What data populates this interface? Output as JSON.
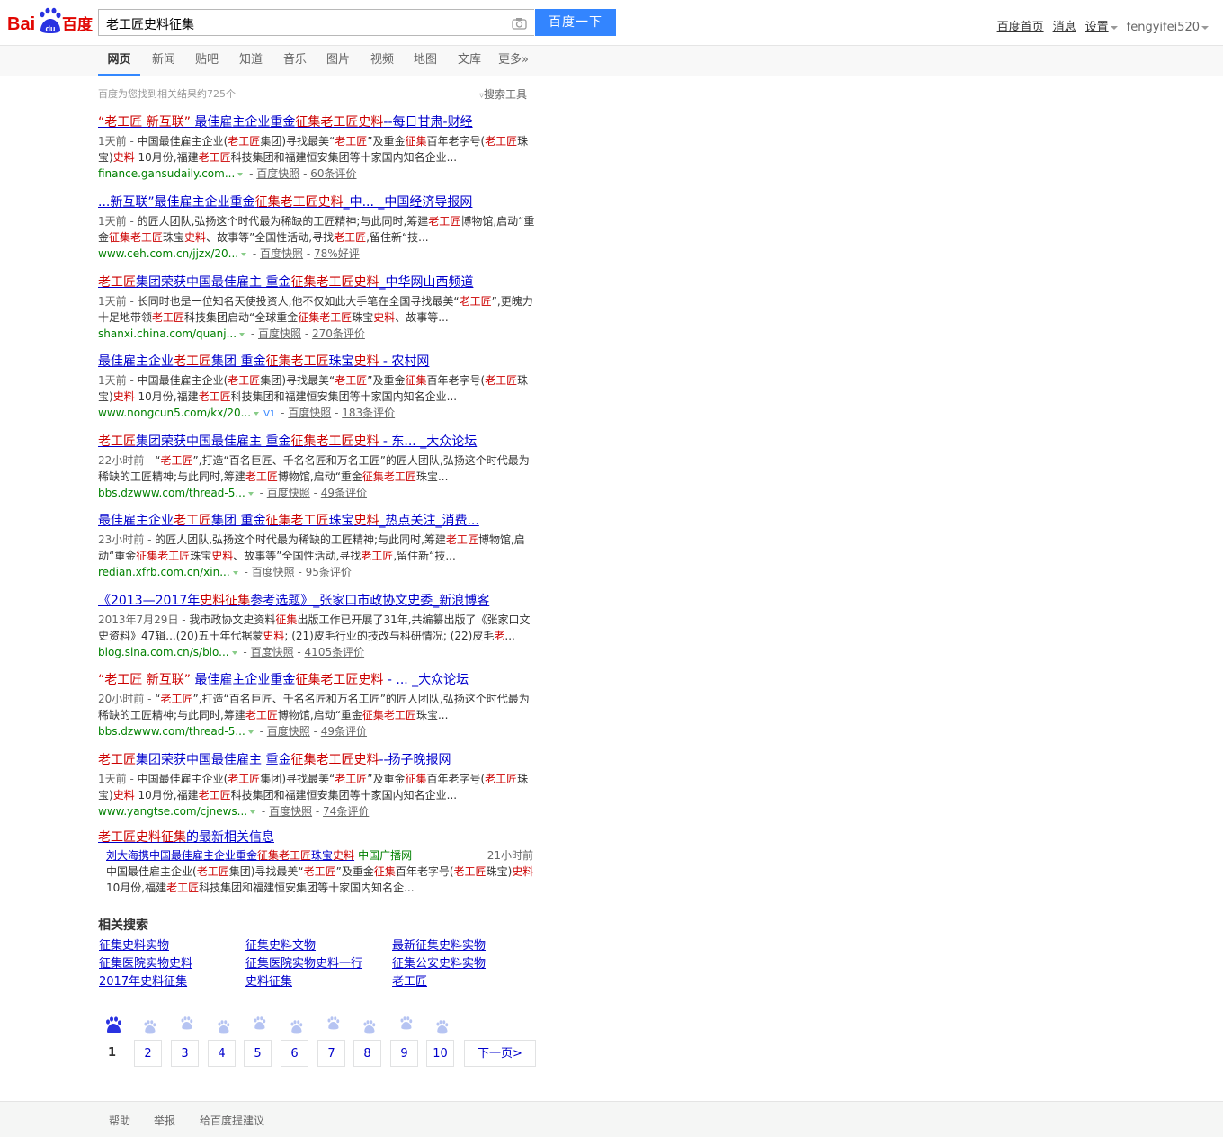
{
  "header": {
    "logo_text_left": "Bai",
    "logo_text_mid": "du",
    "logo_text_right": "百度",
    "search_value": "老工匠史料征集",
    "search_button": "百度一下",
    "user_links": [
      "百度首页",
      "消息",
      "设置",
      "fengyifei520"
    ]
  },
  "tabs": [
    "网页",
    "新闻",
    "贴吧",
    "知道",
    "音乐",
    "图片",
    "视频",
    "地图",
    "文库",
    "更多»"
  ],
  "result_count": "百度为您找到相关结果约725个",
  "search_tools": "搜索工具",
  "results": [
    {
      "title_html": "<em>“老工匠 新互联”</em> 最佳雇主企业重金<em>征集老工匠史料</em>--每日甘肃-财经",
      "date": "1天前 - ",
      "abs_html": "中国最佳雇主企业(<em>老工匠</em>集团)寻找最美“<em>老工匠</em>”及重金<em>征集</em>百年老字号(<em>老工匠</em>珠宝)<em>史料</em> 10月份,福建<em>老工匠</em>科技集团和福建恒安集团等十家国内知名企业...",
      "url": "finance.gansudaily.com...",
      "snapshot": "百度快照",
      "comment": "60条评价",
      "v": ""
    },
    {
      "title_html": "...新互联”最佳雇主企业重金<em>征集老工匠史料</em>_中... _中国经济导报网",
      "date": "1天前 - ",
      "abs_html": "的匠人团队,弘扬这个时代最为稀缺的工匠精神;与此同时,筹建<em>老工匠</em>博物馆,启动“重金<em>征集老工匠</em>珠宝<em>史料</em>、故事等”全国性活动,寻找<em>老工匠</em>,留住新“技...",
      "url": "www.ceh.com.cn/jjzx/20...",
      "snapshot": "百度快照",
      "comment": "78%好评",
      "v": ""
    },
    {
      "title_html": "<em>老工匠</em>集团荣获中国最佳雇主 重金<em>征集老工匠史料</em>_中华网山西频道",
      "date": "1天前 - ",
      "abs_html": "长同时也是一位知名天使投资人,他不仅如此大手笔在全国寻找最美“<em>老工匠</em>”,更魄力十足地带领<em>老工匠</em>科技集团启动“全球重金<em>征集老工匠</em>珠宝<em>史料</em>、故事等...",
      "url": "shanxi.china.com/quanj...",
      "snapshot": "百度快照",
      "comment": "270条评价",
      "v": ""
    },
    {
      "title_html": "最佳雇主企业<em>老工匠</em>集团 重金<em>征集老工匠</em>珠宝<em>史料</em> - 农村网",
      "date": "1天前 - ",
      "abs_html": "中国最佳雇主企业(<em>老工匠</em>集团)寻找最美“<em>老工匠</em>”及重金<em>征集</em>百年老字号(<em>老工匠</em>珠宝)<em>史料</em> 10月份,福建<em>老工匠</em>科技集团和福建恒安集团等十家国内知名企业...",
      "url": "www.nongcun5.com/kx/20...",
      "snapshot": "百度快照",
      "comment": "183条评价",
      "v": "V1"
    },
    {
      "title_html": "<em>老工匠</em>集团荣获中国最佳雇主 重金<em>征集老工匠史料</em> - 东... _大众论坛",
      "date": "22小时前 - ",
      "abs_html": "“<em>老工匠</em>”,打造“百名巨匠、千名名匠和万名工匠”的匠人团队,弘扬这个时代最为稀缺的工匠精神;与此同时,筹建<em>老工匠</em>博物馆,启动“重金<em>征集老工匠</em>珠宝...",
      "url": "bbs.dzwww.com/thread-5...",
      "snapshot": "百度快照",
      "comment": "49条评价",
      "v": ""
    },
    {
      "title_html": "最佳雇主企业<em>老工匠</em>集团 重金<em>征集老工匠</em>珠宝<em>史料</em>_热点关注_消费...",
      "date": "23小时前 - ",
      "abs_html": "的匠人团队,弘扬这个时代最为稀缺的工匠精神;与此同时,筹建<em>老工匠</em>博物馆,启动“重金<em>征集老工匠</em>珠宝<em>史料</em>、故事等”全国性活动,寻找<em>老工匠</em>,留住新“技...",
      "url": "redian.xfrb.com.cn/xin...",
      "snapshot": "百度快照",
      "comment": "95条评价",
      "v": ""
    },
    {
      "title_html": "《2013—2017年<em>史料征集</em>参考选题》_张家口市政协文史委_新浪博客",
      "date": "2013年7月29日 - ",
      "abs_html": "我市政协文史资料<em>征集</em>出版工作已开展了31年,共编纂出版了《张家口文史资料》47辑...(20)五十年代据蒙<em>史料</em>; (21)皮毛行业的技改与科研情况; (22)皮毛<em>老</em>...",
      "url": "blog.sina.com.cn/s/blo...",
      "snapshot": "百度快照",
      "comment": "4105条评价",
      "v": ""
    },
    {
      "title_html": "<em>“老工匠 新互联”</em> 最佳雇主企业重金<em>征集老工匠史料</em> - ... _大众论坛",
      "date": "20小时前 - ",
      "abs_html": "“<em>老工匠</em>”,打造“百名巨匠、千名名匠和万名工匠”的匠人团队,弘扬这个时代最为稀缺的工匠精神;与此同时,筹建<em>老工匠</em>博物馆,启动“重金<em>征集老工匠</em>珠宝...",
      "url": "bbs.dzwww.com/thread-5...",
      "snapshot": "百度快照",
      "comment": "49条评价",
      "v": ""
    },
    {
      "title_html": "<em>老工匠</em>集团荣获中国最佳雇主 重金<em>征集老工匠史料</em>--扬子晚报网",
      "date": "1天前 - ",
      "abs_html": "中国最佳雇主企业(<em>老工匠</em>集团)寻找最美“<em>老工匠</em>”及重金<em>征集</em>百年老字号(<em>老工匠</em>珠宝)<em>史料</em> 10月份,福建<em>老工匠</em>科技集团和福建恒安集团等十家国内知名企业...",
      "url": "www.yangtse.com/cjnews...",
      "snapshot": "百度快照",
      "comment": "74条评价",
      "v": ""
    }
  ],
  "news": {
    "title_html": "<em>老工匠史料征集</em>的最新相关信息",
    "item_title_html": "刘大海携中国最佳雇主企业重金<em>征集老工匠</em>珠宝<em>史料</em>",
    "source": "中国广播网",
    "time": "21小时前",
    "abs_html": "中国最佳雇主企业(<em>老工匠</em>集团)寻找最美“<em>老工匠</em>”及重金<em>征集</em>百年老字号(<em>老工匠</em>珠宝)<em>史料</em> 10月份,福建<em>老工匠</em>科技集团和福建恒安集团等十家国内知名企..."
  },
  "related": {
    "heading": "相关搜索",
    "items": [
      "征集史料实物",
      "征集史料文物",
      "最新征集史料实物",
      "征集医院实物史料",
      "征集医院实物史料一行",
      "征集公安史料实物",
      "2017年史料征集",
      "史料征集",
      "老工匠"
    ]
  },
  "pager": {
    "pages": [
      "1",
      "2",
      "3",
      "4",
      "5",
      "6",
      "7",
      "8",
      "9",
      "10"
    ],
    "next": "下一页>"
  },
  "footer": [
    "帮助",
    "举报",
    "给百度提建议"
  ],
  "colors": {
    "brand_blue": "#3385ff",
    "brand_red": "#e10602",
    "link": "#00c",
    "highlight": "#c00",
    "url_green": "#008000"
  }
}
